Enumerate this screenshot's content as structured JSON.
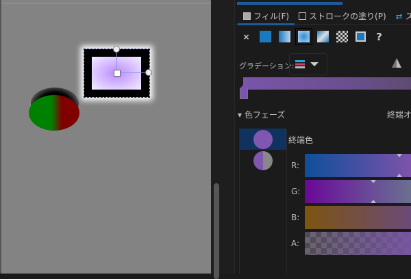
{
  "tabs": [
    {
      "label": "フィル(F)",
      "active": true
    },
    {
      "label": "ストロークの塗り(P)",
      "active": false
    },
    {
      "label": "ス",
      "active": false
    }
  ],
  "fill_types": [
    "no-paint-icon",
    "flat-color-icon",
    "linear-gradient-icon",
    "radial-gradient-icon",
    "mesh-gradient-icon",
    "pattern-icon",
    "swatch-icon",
    "unset-icon"
  ],
  "fill_type_glyphs": {
    "no_paint": "×",
    "unset": "?"
  },
  "gradient": {
    "label": "グラデーション:",
    "bar_color": "#7a55a8"
  },
  "phase": {
    "label": "色フェーズ",
    "end_option": "終端オ"
  },
  "stops": {
    "selected_label": "終端色",
    "colors": [
      "#8156b0",
      "#8156b0"
    ]
  },
  "channels": [
    {
      "label": "R:",
      "from": "#0d4f9a",
      "to": "#7e52aa",
      "value": 0.89
    },
    {
      "label": "G:",
      "from": "#6a0898",
      "to": "#6a7090",
      "value": 0.63
    },
    {
      "label": "B:",
      "from": "#7d5410",
      "to": "#6a4a78",
      "value": null
    },
    {
      "label": "A:",
      "from": "#555555",
      "to": "#7a55a8",
      "value": null
    }
  ],
  "accent": "#1d5a9a"
}
